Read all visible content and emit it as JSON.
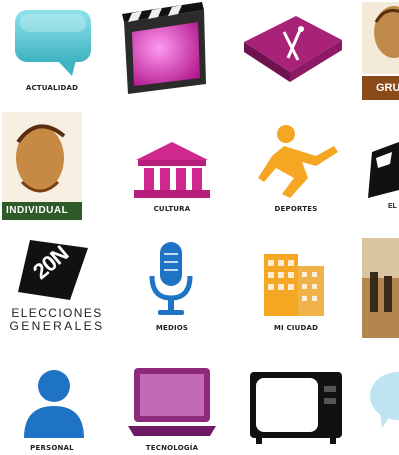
{
  "tiles": {
    "actualidad": {
      "label": "ACTUALIDAD"
    },
    "video": {
      "label": ""
    },
    "comida": {
      "label": ""
    },
    "grupos": {
      "label": "GRU"
    },
    "individual": {
      "label": "INDIVIDUAL"
    },
    "cultura": {
      "label": "CULTURA"
    },
    "deportes": {
      "label": "DEPORTES"
    },
    "el": {
      "label": "EL"
    },
    "elecciones": {
      "label_line1": "ELECCIONES",
      "label_line2": "GENERALES",
      "badge": "20N"
    },
    "medios": {
      "label": "MEDIOS"
    },
    "mi_ciudad": {
      "label": "MI CIUDAD"
    },
    "foto": {
      "label": ""
    },
    "personal": {
      "label": "PERSONAL"
    },
    "tecnologia": {
      "label": "TECNOLOGÍA"
    },
    "tv": {
      "label": ""
    },
    "chat": {
      "label": ""
    }
  },
  "colors": {
    "teal": "#4fc7d3",
    "magenta": "#d0278e",
    "purple": "#8e2a7c",
    "orange": "#f5a623",
    "blue": "#1e73c4",
    "green": "#2d5a27",
    "brown": "#8b4a1a"
  }
}
